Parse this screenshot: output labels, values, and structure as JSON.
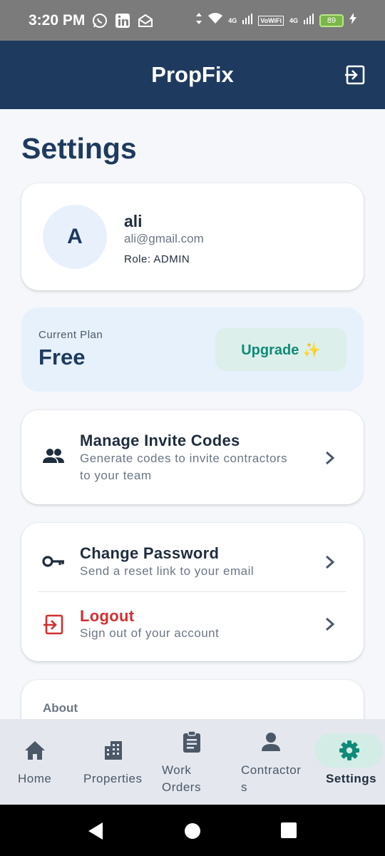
{
  "status_bar": {
    "time": "3:20 PM",
    "battery": "89",
    "net1": "4G",
    "net2": "VoWiFi",
    "net3": "4G"
  },
  "app_bar": {
    "title": "PropFix"
  },
  "page": {
    "title": "Settings"
  },
  "profile": {
    "initial": "A",
    "name": "ali",
    "email": "ali@gmail.com",
    "role": "Role: ADMIN"
  },
  "plan": {
    "label": "Current Plan",
    "value": "Free",
    "upgrade_label": "Upgrade ✨"
  },
  "invite": {
    "title": "Manage Invite Codes",
    "subtitle_line1": "Generate codes to invite contractors",
    "subtitle_line2": "to your team"
  },
  "account": {
    "change_password": {
      "title": "Change Password",
      "subtitle": "Send a reset link to your email"
    },
    "logout": {
      "title": "Logout",
      "subtitle": "Sign out of your account"
    }
  },
  "about": {
    "label": "About"
  },
  "bottom_nav": {
    "home": "Home",
    "properties": "Properties",
    "work_orders_1": "Work",
    "work_orders_2": "Orders",
    "contractors_1": "Contractor",
    "contractors_2": "s",
    "settings": "Settings"
  },
  "colors": {
    "primary": "#1e3a5f",
    "accent": "#0f8a78",
    "danger": "#d32f2f"
  }
}
